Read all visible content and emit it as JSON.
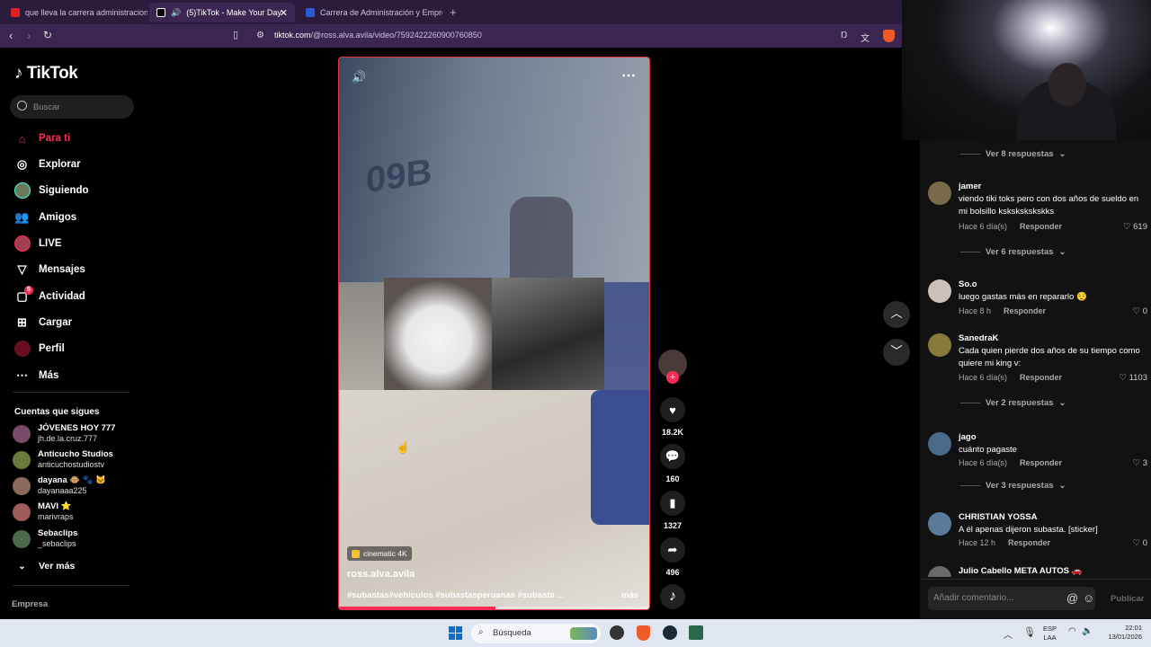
{
  "browser": {
    "tabs": [
      {
        "title": "que lleva la carrera administracion d",
        "active": false,
        "favicon_color": "#e02020"
      },
      {
        "title": "(5)TikTok - Make Your Day",
        "active": true,
        "favicon_color": "#000000"
      },
      {
        "title": "Carrera de Administración y Empren",
        "active": false,
        "favicon_color": "#2a5bd7"
      }
    ],
    "new_tab_icon": "plus-icon",
    "url_host": "tiktok.com",
    "url_path": "/@ross.alva.avila/video/7592422260900760850"
  },
  "sidebar": {
    "logo": "TikTok",
    "search_placeholder": "Buscar",
    "nav": [
      {
        "label": "Para ti",
        "icon": "home-icon",
        "active": true
      },
      {
        "label": "Explorar",
        "icon": "compass-icon",
        "active": false
      },
      {
        "label": "Siguiendo",
        "icon": "avatar",
        "active": false
      },
      {
        "label": "Amigos",
        "icon": "friends-icon",
        "active": false
      },
      {
        "label": "LIVE",
        "icon": "avatar",
        "active": false
      },
      {
        "label": "Mensajes",
        "icon": "send-icon",
        "active": false
      },
      {
        "label": "Actividad",
        "icon": "bell-icon",
        "active": false,
        "badge": "5"
      },
      {
        "label": "Cargar",
        "icon": "plus-square-icon",
        "active": false
      },
      {
        "label": "Perfil",
        "icon": "avatar",
        "active": false
      },
      {
        "label": "Más",
        "icon": "more-icon",
        "active": false
      }
    ],
    "following_title": "Cuentas que sigues",
    "following": [
      {
        "name": "JÓVENES HOY 777",
        "user": "jh.de.la.cruz.777",
        "color": "#7a4a6a"
      },
      {
        "name": "Anticucho Studios",
        "user": "anticuchostudiostv",
        "color": "#6a7a3a"
      },
      {
        "name": "dayana 🐵 🐾 🐱",
        "user": "dayanaaa225",
        "color": "#8a6a5a"
      },
      {
        "name": "MAVI ⭐",
        "user": "marivraps",
        "color": "#a05a5a"
      },
      {
        "name": "Sebaclips",
        "user": "_sebaclips",
        "color": "#4a6a4a"
      }
    ],
    "see_more": "Ver más",
    "footer": "Empresa"
  },
  "video": {
    "badge": "cinematic 4K",
    "author": "ross.alva.avila",
    "caption": "#subastas#vehiculos #subastasperuanas #subasta ...",
    "more": "más",
    "progress": 0.5
  },
  "actions": {
    "likes": "18.2K",
    "comments": "160",
    "saves": "1327",
    "shares": "496"
  },
  "comments": {
    "items": [
      {
        "type": "more",
        "label": "Ver 8 respuestas"
      },
      {
        "type": "comment",
        "name": "jamer",
        "text": "viendo tiki toks pero con dos años de sueldo en mi bolsillo kskskskskskks",
        "time": "Hace 6 día(s)",
        "reply": "Responder",
        "likes": "619",
        "color": "#7a6a4a"
      },
      {
        "type": "more",
        "label": "Ver 6 respuestas"
      },
      {
        "type": "comment",
        "name": "So.o",
        "text": "luego gastas más en repararlo 😌",
        "time": "Hace 8 h",
        "reply": "Responder",
        "likes": "0",
        "color": "#c9c0b8"
      },
      {
        "type": "comment",
        "name": "SanedraK",
        "text": "Cada quien pierde dos años de su tiempo como quiere mi king v:",
        "time": "Hace 6 día(s)",
        "reply": "Responder",
        "likes": "1103",
        "color": "#8a7a3a"
      },
      {
        "type": "more",
        "label": "Ver 2 respuestas"
      },
      {
        "type": "comment",
        "name": "jago",
        "text": "cuánto pagaste",
        "time": "Hace 6 día(s)",
        "reply": "Responder",
        "likes": "3",
        "color": "#4a6a8a"
      },
      {
        "type": "more",
        "label": "Ver 3 respuestas"
      },
      {
        "type": "comment",
        "name": "CHRISTIAN YOSSA",
        "text": "A él apenas dijeron subasta. [sticker]",
        "time": "Hace 12 h",
        "reply": "Responder",
        "likes": "0",
        "color": "#5a7a9a"
      },
      {
        "type": "comment",
        "name": "Julio Cabello META AUTOS 🚗",
        "text": "",
        "time": "",
        "reply": "",
        "likes": "",
        "color": "#6a6a6a"
      }
    ],
    "input_placeholder": "Añadir comentario...",
    "publish": "Publicar"
  },
  "taskbar": {
    "search_placeholder": "Búsqueda",
    "lang": "ESP",
    "lang2": "LAA",
    "time": "22:01",
    "date": "13/01/2026"
  },
  "colors": {
    "accent": "#fe2c55",
    "chrome": "#2b1b3d",
    "address": "#3a2650"
  }
}
